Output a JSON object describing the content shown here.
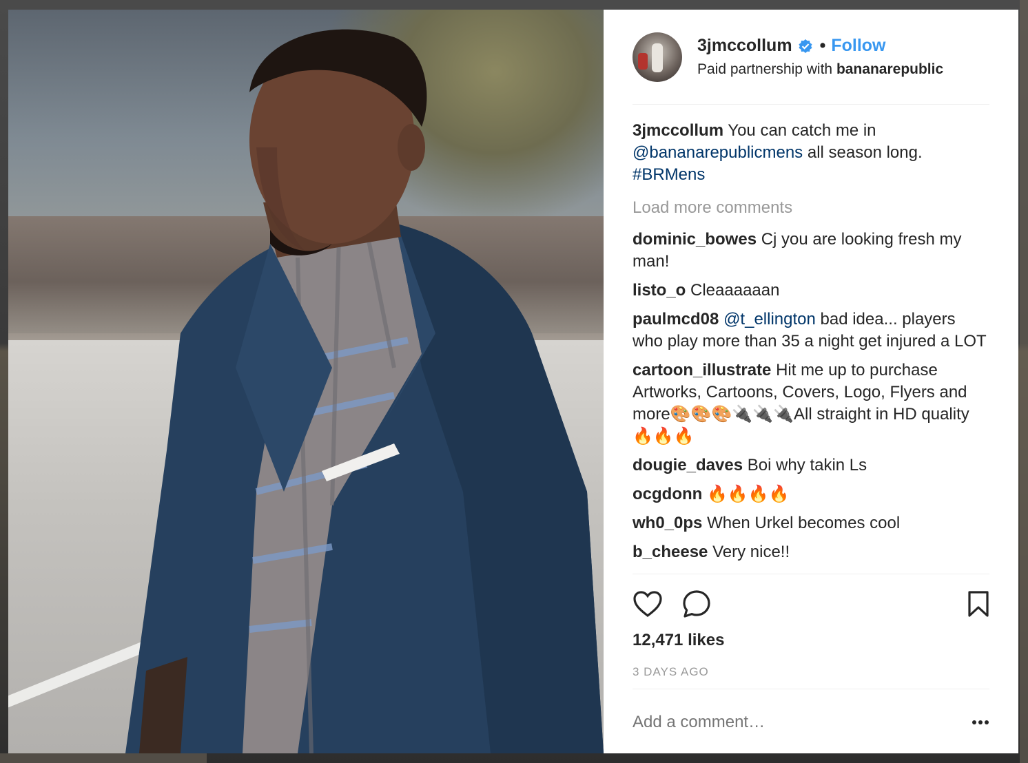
{
  "post": {
    "author": "3jmccollum",
    "follow_label": "Follow",
    "separator": "•",
    "partnership_prefix": "Paid partnership with",
    "partner": "bananarepublic"
  },
  "caption": {
    "author": "3jmccollum",
    "text_1": "You can catch me in",
    "mention": "@bananarepublicmens",
    "text_2": "all season long.",
    "hashtag": "#BRMens"
  },
  "load_more": "Load more comments",
  "comments": [
    {
      "user": "dominic_bowes",
      "text": "Cj you are looking fresh my man!"
    },
    {
      "user": "listo_o",
      "text": "Cleaaaaaan"
    },
    {
      "user": "paulmcd08",
      "mention": "@t_ellington",
      "text": "bad idea... players who play more than 35 a night get injured a LOT"
    },
    {
      "user": "cartoon_illustrate",
      "text": "Hit me up to purchase Artworks, Cartoons, Covers, Logo, Flyers and more🎨🎨🎨🔌🔌🔌All straight in HD quality🔥🔥🔥"
    },
    {
      "user": "dougie_daves",
      "text": "Boi why takin Ls"
    },
    {
      "user": "ocgdonn",
      "text": "🔥🔥🔥🔥"
    },
    {
      "user": "wh0_0ps",
      "text": "When Urkel becomes cool"
    },
    {
      "user": "b_cheese",
      "text": "Very nice!!"
    }
  ],
  "likes": "12,471 likes",
  "time": "3 DAYS AGO",
  "add_comment_placeholder": "Add a comment…",
  "colors": {
    "link": "#003569",
    "follow": "#3897f0",
    "verified": "#3897f0",
    "muted": "#999999"
  },
  "icons": [
    "heart-icon",
    "comment-icon",
    "bookmark-icon",
    "verified-badge-icon",
    "more-options-icon"
  ]
}
